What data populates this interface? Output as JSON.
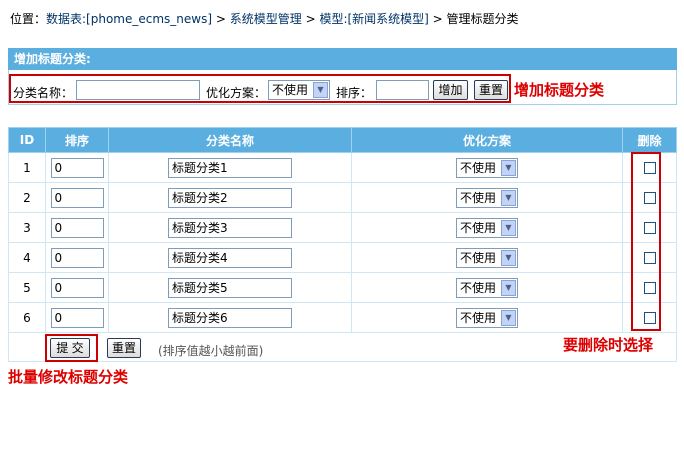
{
  "breadcrumb": {
    "prefix": "位置：",
    "table": "数据表:[phome_ecms_news]",
    "sep1": " > ",
    "model_manage": "系统模型管理",
    "sep2": " > ",
    "model": "模型:[新闻系统模型]",
    "sep3": " > ",
    "current": "管理标题分类"
  },
  "add_panel": {
    "header": "增加标题分类:",
    "name_label": "分类名称：",
    "name_value": "",
    "opt_label": "优化方案：",
    "opt_value": "不使用",
    "order_label": "排序：",
    "order_value": "",
    "add_button": "增加",
    "reset_button": "重置",
    "annotation": "增加标题分类"
  },
  "table": {
    "headers": [
      "ID",
      "排序",
      "分类名称",
      "优化方案",
      "删除"
    ],
    "rows": [
      {
        "id": "1",
        "order": "0",
        "name": "标题分类1",
        "opt": "不使用"
      },
      {
        "id": "2",
        "order": "0",
        "name": "标题分类2",
        "opt": "不使用"
      },
      {
        "id": "3",
        "order": "0",
        "name": "标题分类3",
        "opt": "不使用"
      },
      {
        "id": "4",
        "order": "0",
        "name": "标题分类4",
        "opt": "不使用"
      },
      {
        "id": "5",
        "order": "0",
        "name": "标题分类5",
        "opt": "不使用"
      },
      {
        "id": "6",
        "order": "0",
        "name": "标题分类6",
        "opt": "不使用"
      }
    ],
    "submit_button": "提 交",
    "reset_button": "重置",
    "hint": "(排序值越小越前面)"
  },
  "annotations": {
    "delete_note": "要删除时选择",
    "batch_note": "批量修改标题分类"
  },
  "colors": {
    "header_bg": "#5aaee0",
    "annotation_red": "#dd0000"
  }
}
